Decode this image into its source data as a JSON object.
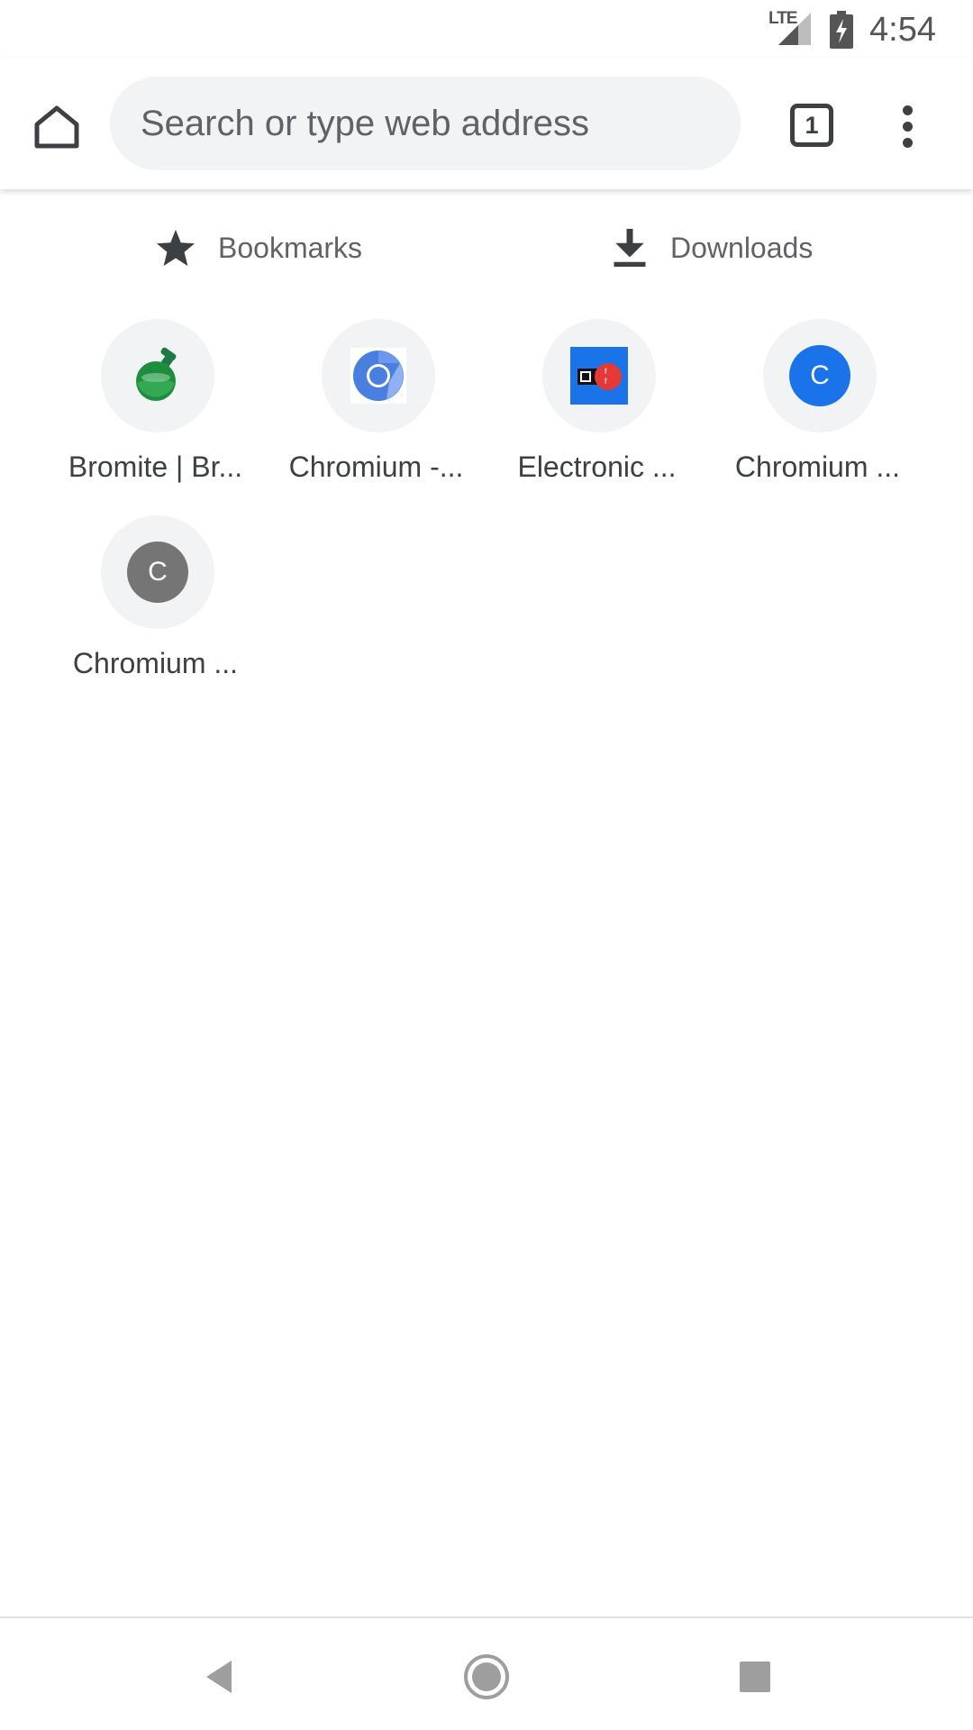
{
  "status_bar": {
    "network": "LTE",
    "time": "4:54",
    "icons": [
      "lte-icon",
      "signal-icon",
      "battery-charging-icon"
    ]
  },
  "toolbar": {
    "home_icon": "home-icon",
    "search_placeholder": "Search or type web address",
    "tab_count": "1",
    "menu_icon": "more-vert-icon"
  },
  "quick_actions": [
    {
      "label": "Bookmarks",
      "icon": "star-icon"
    },
    {
      "label": "Downloads",
      "icon": "download-icon"
    }
  ],
  "tiles": [
    {
      "title": "Bromite | Br...",
      "icon": "bromite-icon"
    },
    {
      "title": "Chromium -...",
      "icon": "chromium-icon"
    },
    {
      "title": "Electronic ...",
      "icon": "eff-icon"
    },
    {
      "title": "Chromium ...",
      "icon": "letter-icon",
      "letter": "C",
      "color": "#1a73e8"
    },
    {
      "title": "Chromium ...",
      "icon": "letter-icon",
      "letter": "C",
      "color": "#757575"
    }
  ],
  "nav_bar": {
    "icons": [
      "back-icon",
      "home-icon",
      "recents-icon"
    ]
  },
  "colors": {
    "omnibox_bg": "#f1f3f4",
    "tile_bg": "#f1f3f4",
    "text_primary": "#3c4043",
    "text_secondary": "#5f6368",
    "accent_blue": "#1a73e8"
  }
}
